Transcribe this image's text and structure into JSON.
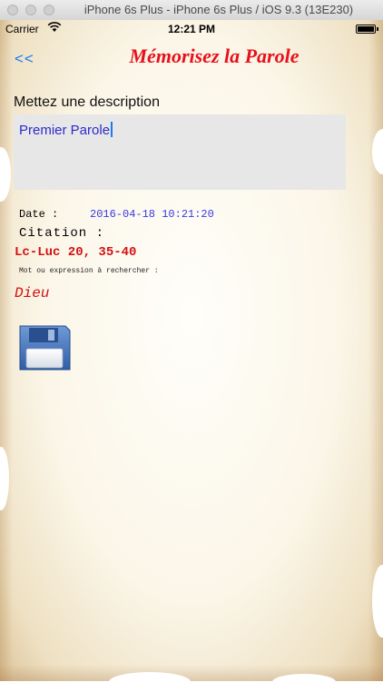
{
  "window": {
    "title": "iPhone 6s Plus - iPhone 6s Plus / iOS 9.3 (13E230)"
  },
  "status_bar": {
    "carrier": "Carrier",
    "time": "12:21 PM"
  },
  "nav": {
    "back_label": "<<",
    "title": "Mémorisez la Parole"
  },
  "form": {
    "description_label": "Mettez une description",
    "description_value": "Premier Parole",
    "date_label": "Date :",
    "date_value": "2016-04-18 10:21:20",
    "citation_label": "Citation :",
    "citation_value": "Lc-Luc 20, 35-40",
    "search_label": "Mot ou expression à rechercher :",
    "search_value": "Dieu"
  },
  "icons": {
    "wifi": "wifi-icon",
    "battery": "battery-icon",
    "save": "floppy-disk-icon"
  },
  "colors": {
    "accent_blue": "#1a7cf0",
    "title_red": "#e8101a",
    "value_red": "#d11212",
    "date_blue": "#3a3ae0"
  }
}
